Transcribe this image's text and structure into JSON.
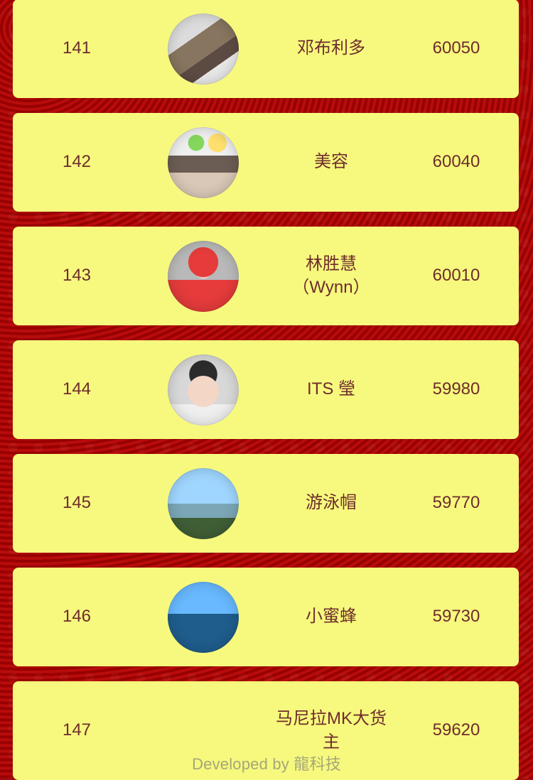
{
  "entries": [
    {
      "rank": "141",
      "name": "邓布利多",
      "score": "60050"
    },
    {
      "rank": "142",
      "name": "美容",
      "score": "60040"
    },
    {
      "rank": "143",
      "name": "林胜慧\n（Wynn）",
      "score": "60010"
    },
    {
      "rank": "144",
      "name": "ITS 瑩",
      "score": "59980"
    },
    {
      "rank": "145",
      "name": "游泳帽",
      "score": "59770"
    },
    {
      "rank": "146",
      "name": "小蜜蜂",
      "score": "59730"
    },
    {
      "rank": "147",
      "name": "马尼拉MK大货\n主",
      "score": "59620"
    }
  ],
  "footer": {
    "text": "Developed by 龍科技"
  }
}
